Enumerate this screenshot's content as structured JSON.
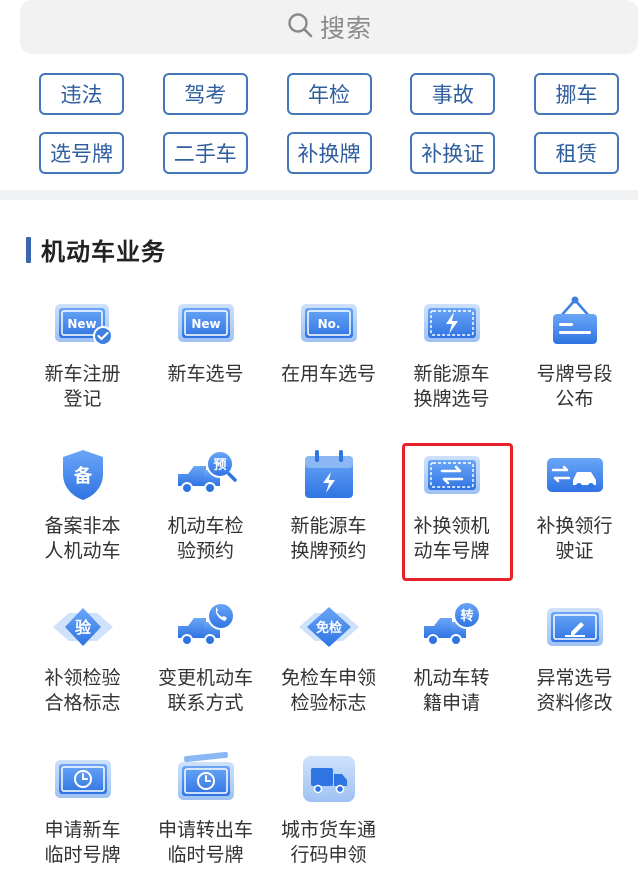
{
  "search": {
    "placeholder": "搜索",
    "icon": "search-icon"
  },
  "tags": [
    [
      "违法",
      "驾考",
      "年检",
      "事故",
      "挪车"
    ],
    [
      "选号牌",
      "二手车",
      "补换牌",
      "补换证",
      "租赁"
    ]
  ],
  "section": {
    "title": "机动车业务"
  },
  "services": [
    {
      "line1": "新车注册",
      "line2": "登记",
      "icon": "plate-new-check-icon",
      "badge": "New"
    },
    {
      "line1": "新车选号",
      "line2": "",
      "icon": "plate-new-icon",
      "badge": "New"
    },
    {
      "line1": "在用车选号",
      "line2": "",
      "icon": "plate-no-icon",
      "badge": "No."
    },
    {
      "line1": "新能源车",
      "line2": "换牌选号",
      "icon": "plate-lightning-icon"
    },
    {
      "line1": "号牌号段",
      "line2": "公布",
      "icon": "signboard-icon"
    },
    {
      "line1": "备案非本",
      "line2": "人机动车",
      "icon": "shield-bei-icon",
      "badge": "备"
    },
    {
      "line1": "机动车检",
      "line2": "验预约",
      "icon": "truck-yu-icon",
      "badge": "预"
    },
    {
      "line1": "新能源车",
      "line2": "换牌预约",
      "icon": "calendar-lightning-icon"
    },
    {
      "line1": "补换领机",
      "line2": "动车号牌",
      "icon": "plate-exchange-icon"
    },
    {
      "line1": "补换领行",
      "line2": "驶证",
      "icon": "car-exchange-icon"
    },
    {
      "line1": "补领检验",
      "line2": "合格标志",
      "icon": "diamond-yan-icon",
      "badge": "验"
    },
    {
      "line1": "变更机动车",
      "line2": "联系方式",
      "icon": "truck-phone-icon"
    },
    {
      "line1": "免检车申领",
      "line2": "检验标志",
      "icon": "diamond-mianjian-icon",
      "badge": "免检"
    },
    {
      "line1": "机动车转",
      "line2": "籍申请",
      "icon": "truck-zhuan-icon",
      "badge": "转"
    },
    {
      "line1": "异常选号",
      "line2": "资料修改",
      "icon": "plate-edit-icon"
    },
    {
      "line1": "申请新车",
      "line2": "临时号牌",
      "icon": "plate-clock-icon"
    },
    {
      "line1": "申请转出车",
      "line2": "临时号牌",
      "icon": "plate-clock-stack-icon"
    },
    {
      "line1": "城市货车通",
      "line2": "行码申领",
      "icon": "truck-box-icon"
    }
  ],
  "colors": {
    "accent": "#3f7fe0",
    "tag_border": "#4576b8",
    "highlight": "#e8202a"
  }
}
